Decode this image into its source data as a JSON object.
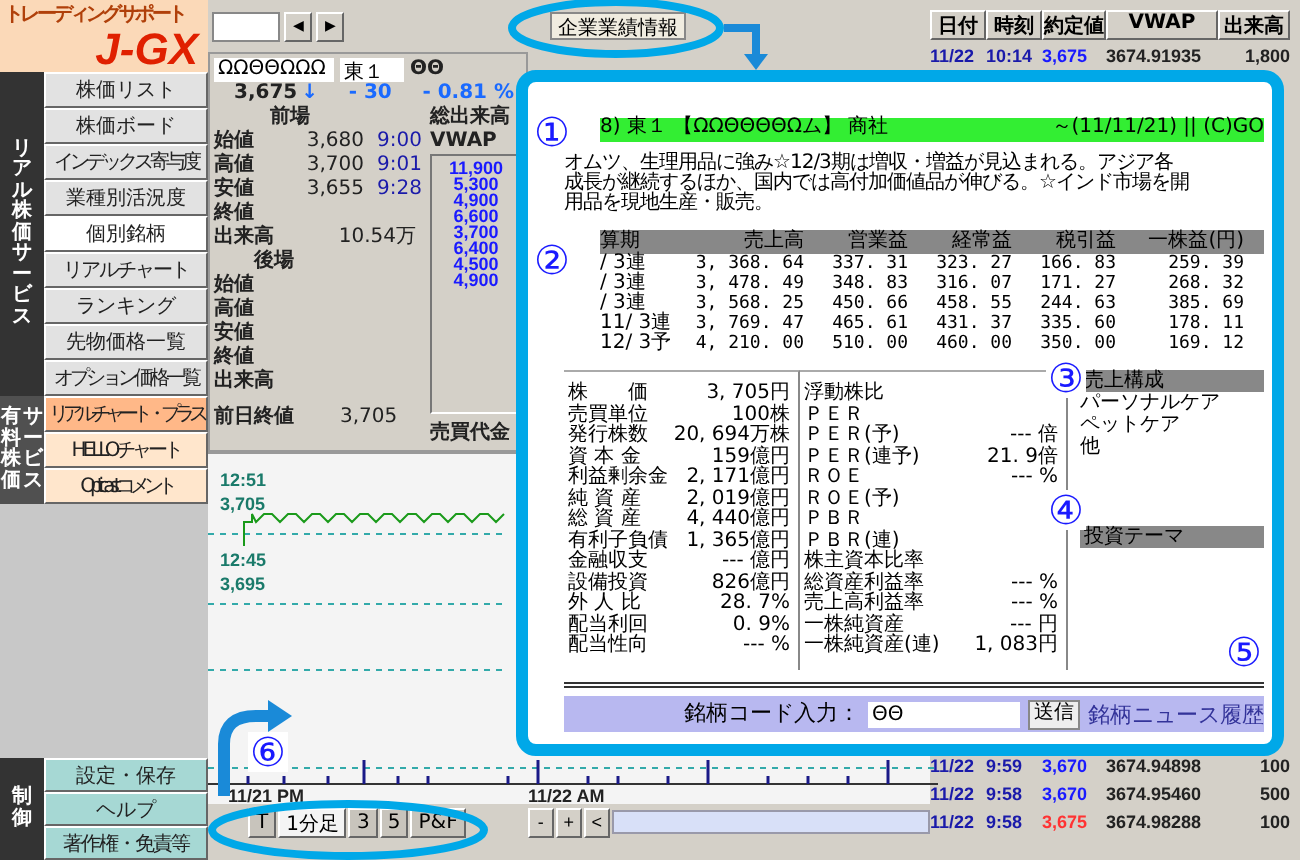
{
  "sidebar": {
    "logo_caption": "トレーディングサポート",
    "logo": "J-GX",
    "groups": [
      {
        "kind": "main",
        "label_lines": [
          "リアル株価サービス"
        ],
        "items": [
          {
            "label": "株価リスト",
            "selected": false,
            "highlighted": false
          },
          {
            "label": "株価ボード",
            "selected": false,
            "highlighted": false
          },
          {
            "label": "インデックス寄与度",
            "selected": false,
            "highlighted": false
          },
          {
            "label": "業種別活況度",
            "selected": false,
            "highlighted": false
          },
          {
            "label": "個別銘柄",
            "selected": true,
            "highlighted": false
          },
          {
            "label": "リアルチャート",
            "selected": false,
            "highlighted": false
          },
          {
            "label": "ランキング",
            "selected": false,
            "highlighted": false
          },
          {
            "label": "先物価格一覧",
            "selected": false,
            "highlighted": false
          },
          {
            "label": "オプション価格一覧",
            "selected": false,
            "highlighted": false
          }
        ]
      },
      {
        "kind": "paid",
        "label_lines": [
          "有料株価",
          "サービス"
        ],
        "items": [
          {
            "label": "リアルチャート・プラス",
            "selected": false,
            "highlighted": true
          },
          {
            "label": "HELLOチャート",
            "selected": false,
            "highlighted": false
          },
          {
            "label": "Opticastコメント",
            "selected": false,
            "highlighted": false
          }
        ]
      },
      {
        "kind": "control",
        "label_lines": [
          "制御"
        ],
        "items": [
          {
            "label": "設定・保存",
            "selected": false,
            "highlighted": false
          },
          {
            "label": "ヘルプ",
            "selected": false,
            "highlighted": false
          },
          {
            "label": "著作権・免責等",
            "selected": false,
            "highlighted": false
          }
        ]
      }
    ]
  },
  "toolbar": {
    "nav_buttons": [
      "◀",
      "▶"
    ],
    "info_button": "企業業績情報"
  },
  "quote": {
    "code": "ΩΩΘΘΩΩΩ",
    "market": "東１",
    "flag": "ΘΘ",
    "price": "3,675",
    "arrow": "↓",
    "change": "- 30",
    "change_pct": "- 0.81 %",
    "morning_label": "前場",
    "afternoon_label": "後場",
    "morning": [
      {
        "label": "始値",
        "value": "3,680",
        "time": "9:00"
      },
      {
        "label": "高値",
        "value": "3,700",
        "time": "9:01"
      },
      {
        "label": "安値",
        "value": "3,655",
        "time": "9:28"
      },
      {
        "label": "終値"
      },
      {
        "label": "出来高",
        "value": "10.54万"
      }
    ],
    "afternoon": [
      {
        "label": "始値"
      },
      {
        "label": "高値"
      },
      {
        "label": "安値"
      },
      {
        "label": "終値"
      },
      {
        "label": "出来高"
      }
    ],
    "total_volume_label": "総出来高",
    "vwap_label": "VWAP",
    "volumes": [
      "11,900",
      "5,300",
      "4,900",
      "6,600",
      "3,700",
      "6,400",
      "4,500",
      "4,900"
    ],
    "prev_close_label": "前日終値",
    "prev_close": "3,705",
    "turnover_label": "売買代金"
  },
  "chart": {
    "high_time": "12:51",
    "high_price": "3,705",
    "low_time": "12:45",
    "low_price": "3,695",
    "x_labels": [
      "11/21 PM",
      "11/22 AM"
    ]
  },
  "chart_tabs": [
    {
      "label": "T",
      "selected": false
    },
    {
      "label": "1分足",
      "selected": true
    },
    {
      "label": "3",
      "selected": false
    },
    {
      "label": "5",
      "selected": false
    },
    {
      "label": "P&F",
      "selected": false
    }
  ],
  "zoom_buttons": [
    "-",
    "+",
    "<"
  ],
  "ticks": {
    "columns": [
      "日付",
      "時刻",
      "約定値",
      "VWAP",
      "出来高"
    ],
    "rows_top": [
      {
        "date": "11/22",
        "time": "10:14",
        "price": "3,675",
        "color": "#1a1aff",
        "vwap": "3674.91935",
        "volume": "1,800"
      }
    ],
    "rows_bottom": [
      {
        "date": "11/22",
        "time": "9:59",
        "price": "3,670",
        "color": "#1a1aff",
        "vwap": "3674.94898",
        "volume": "100"
      },
      {
        "date": "11/22",
        "time": "9:58",
        "price": "3,670",
        "color": "#1a1aff",
        "vwap": "3674.95460",
        "volume": "500"
      },
      {
        "date": "11/22",
        "time": "9:58",
        "price": "3,675",
        "color": "#ff3333",
        "vwap": "3674.98288",
        "volume": "100"
      }
    ]
  },
  "report": {
    "header_left": "8) 東１ 【ΩΩΘΘΘΘΩム】 商社",
    "header_right": "～(11/11/21) || (C)GO",
    "description": [
      "オムツ、生理用品に強み☆12/3期は増収・増益が見込まれる。アジア各",
      "成長が継続するほか、国内では高付加価値品が伸びる。☆インド市場を開",
      "用品を現地生産・販売。"
    ],
    "earnings": {
      "columns": [
        "算期",
        "売上高",
        "営業益",
        "経常益",
        "税引益",
        "一株益(円)"
      ],
      "rows": [
        [
          "/ 3連",
          "3, 368. 64",
          "337. 31",
          "323. 27",
          "166. 83",
          "259. 39"
        ],
        [
          "/ 3連",
          "3, 478. 49",
          "348. 83",
          "316. 07",
          "171. 27",
          "268. 32"
        ],
        [
          "/ 3連",
          "3, 568. 25",
          "450. 66",
          "458. 55",
          "244. 63",
          "385. 69"
        ],
        [
          "11/ 3連",
          "3, 769. 47",
          "465. 61",
          "431. 37",
          "335. 60",
          "178. 11"
        ],
        [
          "12/ 3予",
          "4, 210. 00",
          "510. 00",
          "460. 00",
          "350. 00",
          "169. 12"
        ]
      ]
    },
    "stats_left": [
      {
        "label": "株　　価",
        "value": "3, 705円"
      },
      {
        "label": "売買単位",
        "value": "100株"
      },
      {
        "label": "発行株数",
        "value": "20, 694万株"
      },
      {
        "label": "資 本 金",
        "value": "159億円"
      },
      {
        "label": "利益剰余金",
        "value": "2, 171億円"
      },
      {
        "label": "純 資 産",
        "value": "2, 019億円"
      },
      {
        "label": "総 資 産",
        "value": "4, 440億円"
      },
      {
        "label": "有利子負債",
        "value": "1, 365億円"
      },
      {
        "label": "金融収支",
        "value": "--- 億円"
      },
      {
        "label": "設備投資",
        "value": "826億円"
      },
      {
        "label": "外 人 比",
        "value": "28. 7%"
      },
      {
        "label": "配当利回",
        "value": "0. 9%"
      },
      {
        "label": "配当性向",
        "value": "--- %"
      }
    ],
    "stats_right": [
      {
        "label": "浮動株比"
      },
      {
        "label": "ＰＥＲ"
      },
      {
        "label": "ＰＥＲ(予)",
        "value": "--- 倍"
      },
      {
        "label": "ＰＥＲ(連予)",
        "value": "21. 9倍"
      },
      {
        "label": "ＲＯＥ",
        "value": "--- %"
      },
      {
        "label": "ＲＯＥ(予)"
      },
      {
        "label": "ＰＢＲ"
      },
      {
        "label": "ＰＢＲ(連)"
      },
      {
        "label": "株主資本比率"
      },
      {
        "label": "総資産利益率",
        "value": "--- %"
      },
      {
        "label": "売上高利益率",
        "value": "--- %"
      },
      {
        "label": "一株純資産",
        "value": "--- 円"
      },
      {
        "label": "一株純資産(連)",
        "value": "1, 083円"
      }
    ],
    "sales_title": "売上構成",
    "sales_items": [
      "パーソナルケア",
      "ペットケア",
      "他"
    ],
    "theme_title": "投資テーマ",
    "code_label": "銘柄コード入力：",
    "code_value": "ΘΘ",
    "submit": "送信",
    "news_link": "銘柄ニュース履歴"
  },
  "callouts": [
    "①",
    "②",
    "③",
    "④",
    "⑤",
    "⑥"
  ]
}
